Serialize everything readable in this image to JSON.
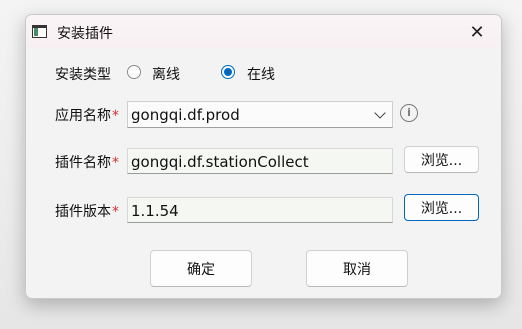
{
  "window": {
    "title": "安装插件",
    "close_glyph": "✕"
  },
  "install_type": {
    "label": "安装类型",
    "options": [
      {
        "label": "离线",
        "checked": false
      },
      {
        "label": "在线",
        "checked": true
      }
    ]
  },
  "app_name": {
    "label": "应用名称",
    "required_mark": "*",
    "value": "gongqi.df.prod",
    "info_glyph": "i"
  },
  "plugin_name": {
    "label": "插件名称",
    "required_mark": "*",
    "value": "gongqi.df.stationCollect",
    "browse_label": "浏览..."
  },
  "plugin_version": {
    "label": "插件版本",
    "required_mark": "*",
    "value": "1.1.54",
    "browse_label": "浏览..."
  },
  "actions": {
    "ok_label": "确定",
    "cancel_label": "取消"
  },
  "colors": {
    "accent": "#0067c0",
    "required": "#d0302f"
  }
}
